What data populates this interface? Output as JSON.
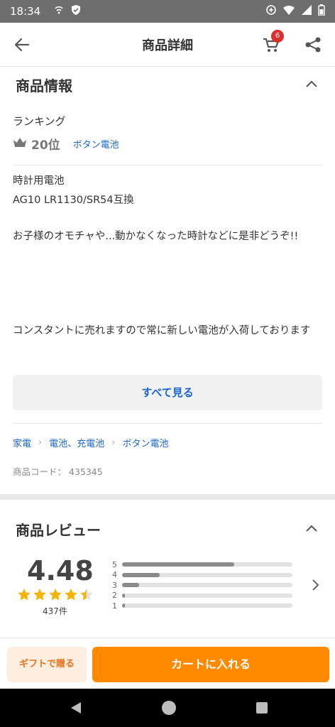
{
  "status_bar": {
    "time": "18:34"
  },
  "app_bar": {
    "title": "商品詳細",
    "cart_count": "6"
  },
  "product_info": {
    "header": "商品情報",
    "ranking_label": "ランキング",
    "rank": "20位",
    "rank_category": "ボタン電池",
    "description": [
      "時計用電池",
      "AG10 LR1130/SR54互換",
      "お子様のオモチャや...動かなくなった時計などに是非どうぞ!!",
      "コンスタントに売れますので常に新しい電池が入荷しております"
    ],
    "see_all": "すべて見る",
    "breadcrumb": [
      "家電",
      "電池、充電池",
      "ボタン電池"
    ],
    "product_code_label": "商品コード：",
    "product_code": "435345"
  },
  "reviews": {
    "header": "商品レビュー",
    "score": "4.48",
    "stars": 4.48,
    "count": "437件",
    "distribution": [
      {
        "label": "5",
        "fraction": 0.66
      },
      {
        "label": "4",
        "fraction": 0.22
      },
      {
        "label": "3",
        "fraction": 0.1
      },
      {
        "label": "2",
        "fraction": 0.015
      },
      {
        "label": "1",
        "fraction": 0.015
      }
    ]
  },
  "bottom_bar": {
    "gift_label": "ギフトで贈る",
    "add_to_cart_label": "カートに入れる"
  },
  "colors": {
    "accent_orange": "#ff8a00",
    "link_blue": "#1a66cc",
    "star_gold": "#f5b400",
    "badge_red": "#d9302b"
  }
}
